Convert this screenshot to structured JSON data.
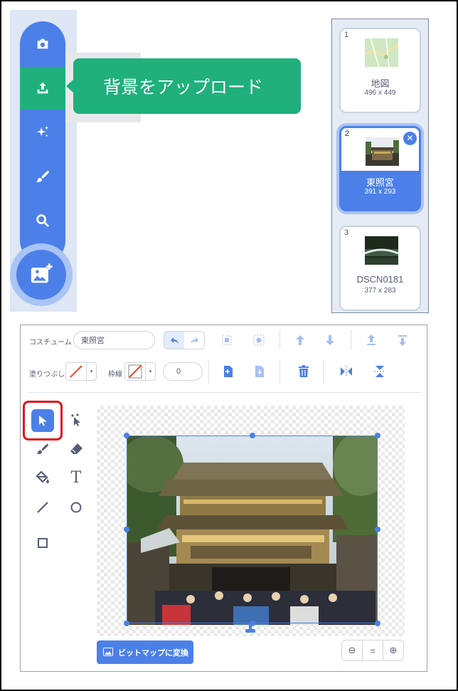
{
  "tooltip": {
    "text": "背景をアップロード"
  },
  "backdrop_menu": {
    "items": [
      {
        "icon": "camera-icon"
      },
      {
        "icon": "upload-icon",
        "active": true
      },
      {
        "icon": "sparkle-surprise-icon"
      },
      {
        "icon": "paintbrush-icon"
      },
      {
        "icon": "search-icon"
      }
    ],
    "main_icon": "add-backdrop-icon"
  },
  "costumes": [
    {
      "number": "1",
      "name": "地図",
      "size": "496 x 449",
      "selected": false
    },
    {
      "number": "2",
      "name": "東照宮",
      "size": "391 x 293",
      "selected": true,
      "delete_label": "✕"
    },
    {
      "number": "3",
      "name": "DSCN0181",
      "size": "377 x 283",
      "selected": false
    }
  ],
  "editor": {
    "costume_label": "コスチューム",
    "costume_name": "東照宮",
    "fill_label": "塗りつぶし",
    "outline_label": "枠線",
    "outline_width": "0",
    "dropdown_glyph": "▾",
    "convert_button": "ビットマップに変換",
    "zoom": {
      "out": "⊖",
      "reset": "=",
      "in": "⊕"
    },
    "tools": [
      "select",
      "reshape",
      "brush",
      "eraser",
      "fill",
      "text",
      "line",
      "circle",
      "rectangle"
    ],
    "selected_tool": "select",
    "text_tool_glyph": "T"
  },
  "colors": {
    "accent_blue": "#4c80e8",
    "upload_green": "#1fb07c",
    "highlight_red": "#e0161b"
  }
}
